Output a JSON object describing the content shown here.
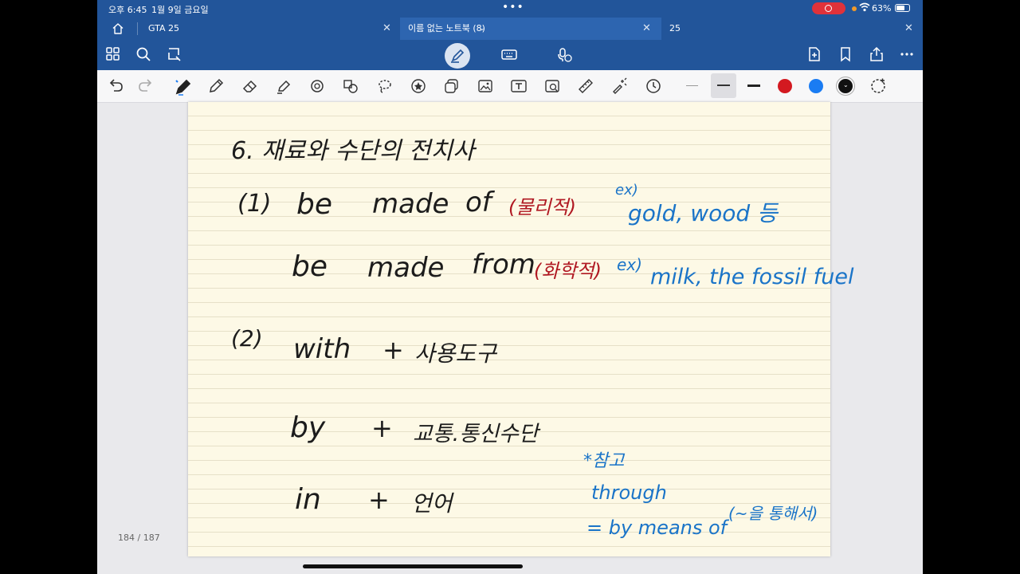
{
  "status_bar": {
    "time": "오후 6:45",
    "date": "1월 9일 금요일",
    "battery": "63%"
  },
  "tabs": [
    {
      "label": "GTA 25"
    },
    {
      "label": "이름 없는 노트북 (8)"
    },
    {
      "label": "25"
    }
  ],
  "toolbar_icons": [
    "undo-icon",
    "redo-icon",
    "pen-icon",
    "pencil-icon",
    "eraser-icon",
    "highlighter-icon",
    "shapes-icon",
    "lasso-icon",
    "element-icon",
    "star-icon",
    "sticker-icon",
    "image-icon",
    "text-icon",
    "camera-image-icon",
    "ruler-icon",
    "laser-icon",
    "timer-icon"
  ],
  "colors": {
    "red": "#d31920",
    "blue": "#1a7cf3",
    "black": "#111111",
    "accent": "#22559a"
  },
  "page_indicator": "184 / 187",
  "note": {
    "heading": "6. 재료와 수단의 전치사",
    "l1_num": "(1)",
    "l1_a": "be",
    "l1_b": "made",
    "l1_c": "of",
    "l1_red": "(물리적)",
    "l1_ex": "ex)",
    "l1_blue": "gold, wood 등",
    "l2_a": "be",
    "l2_b": "made",
    "l2_c": "from",
    "l2_red": "(화학적)",
    "l2_ex": "ex)",
    "l2_blue": "milk, the fossil fuel",
    "l3_num": "(2)",
    "l3_a": "with",
    "l3_plus": "+",
    "l3_b": "사용도구",
    "l4_a": "by",
    "l4_plus": "+",
    "l4_b": "교통.통신수단",
    "l5_a": "in",
    "l5_plus": "+",
    "l5_b": "언어",
    "ref_star": "*참고",
    "ref_through": "through",
    "ref_means": "= by means of",
    "ref_paren": "(~을 통해서)"
  }
}
